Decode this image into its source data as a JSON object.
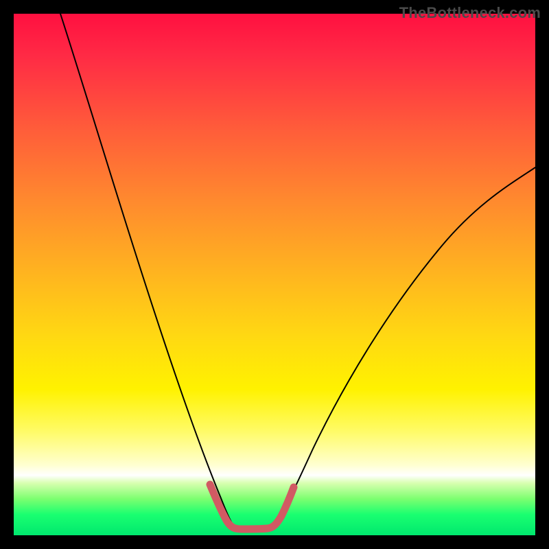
{
  "watermark": "TheBottleneck.com",
  "colors": {
    "frame": "#000000",
    "curve_black": "#000000",
    "hotzone_stroke": "#d15a63"
  },
  "chart_data": {
    "type": "line",
    "title": "",
    "xlabel": "",
    "ylabel": "",
    "xlim": [
      0,
      100
    ],
    "ylim": [
      0,
      100
    ],
    "note": "No axes, ticks, or numeric labels are rendered in the image; curve values below are estimated from pixel positions with (0,0) at the bottom-left of the gradient plot area.",
    "series": [
      {
        "name": "left-branch",
        "x": [
          9,
          12,
          16,
          20,
          24,
          28,
          31,
          34,
          36.5,
          38.5,
          40
        ],
        "y": [
          100,
          90,
          78,
          66,
          54,
          42,
          31,
          21,
          12.5,
          6.5,
          2.5
        ]
      },
      {
        "name": "right-branch",
        "x": [
          50,
          52,
          55,
          58,
          62,
          67,
          73,
          80,
          88,
          96,
          100
        ],
        "y": [
          2.5,
          6.5,
          12,
          18,
          25,
          32.5,
          41,
          50,
          58.5,
          66.5,
          70.5
        ]
      },
      {
        "name": "hot-zone-flat",
        "x": [
          40,
          42,
          45,
          48,
          50
        ],
        "y": [
          2.5,
          1.4,
          1.2,
          1.4,
          2.5
        ]
      },
      {
        "name": "hot-zone-left-stub",
        "x": [
          37.5,
          38.5,
          40
        ],
        "y": [
          9.5,
          6,
          2.8
        ]
      },
      {
        "name": "hot-zone-right-stub",
        "x": [
          50,
          51.5,
          53
        ],
        "y": [
          2.8,
          6,
          9.7
        ]
      }
    ],
    "background_gradient_stops": [
      {
        "pos": 0.0,
        "color": "#ff1040"
      },
      {
        "pos": 0.5,
        "color": "#ffb51f"
      },
      {
        "pos": 0.72,
        "color": "#fff200"
      },
      {
        "pos": 0.885,
        "color": "#ffffff"
      },
      {
        "pos": 1.0,
        "color": "#00e86e"
      }
    ]
  }
}
